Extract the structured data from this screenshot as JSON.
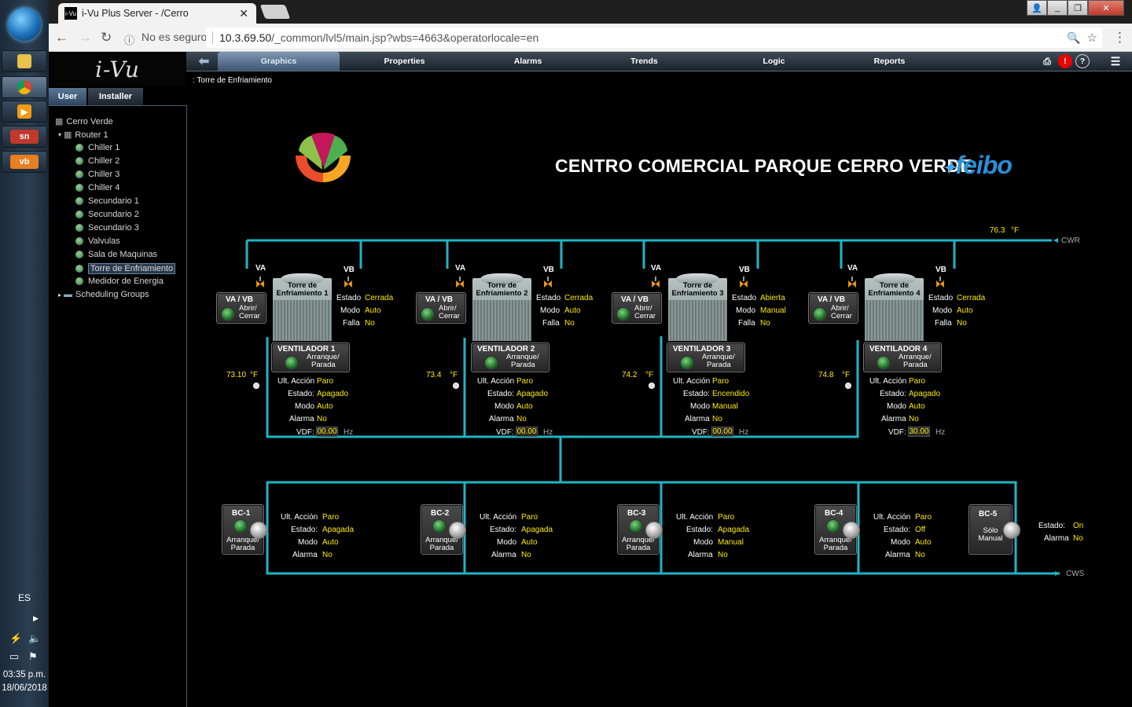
{
  "taskbar": {
    "apps": [
      {
        "name": "explorer-icon",
        "label": ""
      },
      {
        "name": "chrome-icon",
        "label": ""
      },
      {
        "name": "media-icon",
        "label": ""
      },
      {
        "name": "sn-icon",
        "label": "sn"
      },
      {
        "name": "vb-icon",
        "label": "vb"
      }
    ],
    "language": "ES",
    "time": "03:35 p.m.",
    "date": "18/06/2018"
  },
  "browser": {
    "tab_title": "i-Vu Plus Server - /Cerro",
    "tab_favicon": "i-Vu",
    "security_label": "No es seguro",
    "url_host": "10.3.69.50",
    "url_path": "/_common/lvl5/main.jsp?wbs=4663&operatorlocale=en"
  },
  "app": {
    "logo": "i-Vu",
    "nav": [
      "Graphics",
      "Properties",
      "Alarms",
      "Trends",
      "Logic",
      "Reports"
    ],
    "active_nav": "Graphics",
    "breadcrumb": ": Torre de Enfriamiento",
    "left_tabs": [
      "User",
      "Installer"
    ],
    "tree": {
      "root": "Cerro Verde",
      "router": "Router 1",
      "items": [
        "Chiller 1",
        "Chiller 2",
        "Chiller 3",
        "Chiller 4",
        "Secundario 1",
        "Secundario 2",
        "Secundario 3",
        "Valvulas",
        "Sala de Maquinas",
        "Torre de Enfriamiento",
        "Medidor de Energia"
      ],
      "selected": "Torre de Enfriamiento",
      "scheduling": "Scheduling Groups"
    }
  },
  "graphic": {
    "title": "CENTRO COMERCIAL PARQUE CERRO VERDE",
    "brand": "feibo",
    "cwr_temp": "76.3",
    "cwr_unit": "°F",
    "cwr_label": "CWR",
    "cws_label": "CWS",
    "labels": {
      "va": "VA",
      "vb": "VB",
      "vavb": "VA / VB",
      "abrir": "Abrir/",
      "cerrar": "Cerrar",
      "estado": "Estado",
      "modo": "Modo",
      "falla": "Falla",
      "arranque": "Arranque/",
      "parada": "Parada",
      "ult_accion": "Ult. Acción",
      "estado_c": "Estado:",
      "modo2": "Modo",
      "alarma": "Alarma",
      "vdf": "VDF:",
      "hz": "Hz",
      "unit_f": "°F",
      "torre_de": "Torre de"
    },
    "towers": [
      {
        "name": "Enfriamiento 1",
        "estado": "Cerrada",
        "modo": "Auto",
        "falla": "No",
        "fan": "VENTILADOR 1",
        "temp": "73.10",
        "ult": "Paro",
        "fan_estado": "Apagado",
        "fan_modo": "Auto",
        "alarma": "No",
        "vdf": "00.00"
      },
      {
        "name": "Enfriamiento 2",
        "estado": "Cerrada",
        "modo": "Auto",
        "falla": "No",
        "fan": "VENTILADOR 2",
        "temp": "73.4",
        "ult": "Paro",
        "fan_estado": "Apagado",
        "fan_modo": "Auto",
        "alarma": "No",
        "vdf": "00.00"
      },
      {
        "name": "Enfriamiento 3",
        "estado": "Abierta",
        "modo": "Manual",
        "falla": "No",
        "fan": "VENTILADOR 3",
        "temp": "74.2",
        "ult": "Paro",
        "fan_estado": "Encendido",
        "fan_modo": "Manual",
        "alarma": "No",
        "vdf": "00.00"
      },
      {
        "name": "Enfriamiento 4",
        "estado": "Cerrada",
        "modo": "Auto",
        "falla": "No",
        "fan": "VENTILADOR 4",
        "temp": "74.8",
        "ult": "Paro",
        "fan_estado": "Apagado",
        "fan_modo": "Auto",
        "alarma": "No",
        "vdf": "30.00"
      }
    ],
    "pumps": [
      {
        "name": "BC-1",
        "sub1": "Arranque/",
        "sub2": "Parada",
        "ult": "Paro",
        "estado": "Apagada",
        "modo": "Auto",
        "alarma": "No"
      },
      {
        "name": "BC-2",
        "sub1": "Arranque/",
        "sub2": "Parada",
        "ult": "Paro",
        "estado": "Apagada",
        "modo": "Auto",
        "alarma": "No"
      },
      {
        "name": "BC-3",
        "sub1": "Arranque/",
        "sub2": "Parada",
        "ult": "Paro",
        "estado": "Apagada",
        "modo": "Manual",
        "alarma": "No"
      },
      {
        "name": "BC-4",
        "sub1": "Arranque/",
        "sub2": "Parada",
        "ult": "Paro",
        "estado": "Off",
        "modo": "Auto",
        "alarma": "No"
      }
    ],
    "pump5": {
      "name": "BC-5",
      "sub1": "Sólo",
      "sub2": "Manual",
      "estado_label": "Estado:",
      "estado": "On",
      "alarma_label": "Alarma",
      "alarma": "No"
    },
    "colors": {
      "pipe": "#1fb5c4",
      "value": "#ffeb00"
    }
  }
}
